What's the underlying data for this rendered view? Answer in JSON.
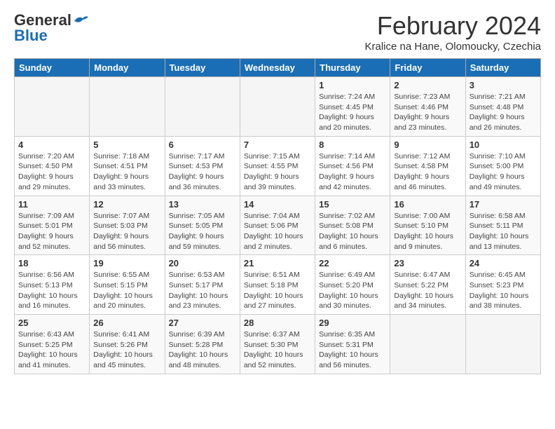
{
  "header": {
    "logo_general": "General",
    "logo_blue": "Blue",
    "month_title": "February 2024",
    "subtitle": "Kralice na Hane, Olomoucky, Czechia"
  },
  "days_of_week": [
    "Sunday",
    "Monday",
    "Tuesday",
    "Wednesday",
    "Thursday",
    "Friday",
    "Saturday"
  ],
  "weeks": [
    [
      {
        "day": null
      },
      {
        "day": null
      },
      {
        "day": null
      },
      {
        "day": null
      },
      {
        "day": 1,
        "sunrise": "7:24 AM",
        "sunset": "4:45 PM",
        "daylight": "9 hours and 20 minutes."
      },
      {
        "day": 2,
        "sunrise": "7:23 AM",
        "sunset": "4:46 PM",
        "daylight": "9 hours and 23 minutes."
      },
      {
        "day": 3,
        "sunrise": "7:21 AM",
        "sunset": "4:48 PM",
        "daylight": "9 hours and 26 minutes."
      }
    ],
    [
      {
        "day": 4,
        "sunrise": "7:20 AM",
        "sunset": "4:50 PM",
        "daylight": "9 hours and 29 minutes."
      },
      {
        "day": 5,
        "sunrise": "7:18 AM",
        "sunset": "4:51 PM",
        "daylight": "9 hours and 33 minutes."
      },
      {
        "day": 6,
        "sunrise": "7:17 AM",
        "sunset": "4:53 PM",
        "daylight": "9 hours and 36 minutes."
      },
      {
        "day": 7,
        "sunrise": "7:15 AM",
        "sunset": "4:55 PM",
        "daylight": "9 hours and 39 minutes."
      },
      {
        "day": 8,
        "sunrise": "7:14 AM",
        "sunset": "4:56 PM",
        "daylight": "9 hours and 42 minutes."
      },
      {
        "day": 9,
        "sunrise": "7:12 AM",
        "sunset": "4:58 PM",
        "daylight": "9 hours and 46 minutes."
      },
      {
        "day": 10,
        "sunrise": "7:10 AM",
        "sunset": "5:00 PM",
        "daylight": "9 hours and 49 minutes."
      }
    ],
    [
      {
        "day": 11,
        "sunrise": "7:09 AM",
        "sunset": "5:01 PM",
        "daylight": "9 hours and 52 minutes."
      },
      {
        "day": 12,
        "sunrise": "7:07 AM",
        "sunset": "5:03 PM",
        "daylight": "9 hours and 56 minutes."
      },
      {
        "day": 13,
        "sunrise": "7:05 AM",
        "sunset": "5:05 PM",
        "daylight": "9 hours and 59 minutes."
      },
      {
        "day": 14,
        "sunrise": "7:04 AM",
        "sunset": "5:06 PM",
        "daylight": "10 hours and 2 minutes."
      },
      {
        "day": 15,
        "sunrise": "7:02 AM",
        "sunset": "5:08 PM",
        "daylight": "10 hours and 6 minutes."
      },
      {
        "day": 16,
        "sunrise": "7:00 AM",
        "sunset": "5:10 PM",
        "daylight": "10 hours and 9 minutes."
      },
      {
        "day": 17,
        "sunrise": "6:58 AM",
        "sunset": "5:11 PM",
        "daylight": "10 hours and 13 minutes."
      }
    ],
    [
      {
        "day": 18,
        "sunrise": "6:56 AM",
        "sunset": "5:13 PM",
        "daylight": "10 hours and 16 minutes."
      },
      {
        "day": 19,
        "sunrise": "6:55 AM",
        "sunset": "5:15 PM",
        "daylight": "10 hours and 20 minutes."
      },
      {
        "day": 20,
        "sunrise": "6:53 AM",
        "sunset": "5:17 PM",
        "daylight": "10 hours and 23 minutes."
      },
      {
        "day": 21,
        "sunrise": "6:51 AM",
        "sunset": "5:18 PM",
        "daylight": "10 hours and 27 minutes."
      },
      {
        "day": 22,
        "sunrise": "6:49 AM",
        "sunset": "5:20 PM",
        "daylight": "10 hours and 30 minutes."
      },
      {
        "day": 23,
        "sunrise": "6:47 AM",
        "sunset": "5:22 PM",
        "daylight": "10 hours and 34 minutes."
      },
      {
        "day": 24,
        "sunrise": "6:45 AM",
        "sunset": "5:23 PM",
        "daylight": "10 hours and 38 minutes."
      }
    ],
    [
      {
        "day": 25,
        "sunrise": "6:43 AM",
        "sunset": "5:25 PM",
        "daylight": "10 hours and 41 minutes."
      },
      {
        "day": 26,
        "sunrise": "6:41 AM",
        "sunset": "5:26 PM",
        "daylight": "10 hours and 45 minutes."
      },
      {
        "day": 27,
        "sunrise": "6:39 AM",
        "sunset": "5:28 PM",
        "daylight": "10 hours and 48 minutes."
      },
      {
        "day": 28,
        "sunrise": "6:37 AM",
        "sunset": "5:30 PM",
        "daylight": "10 hours and 52 minutes."
      },
      {
        "day": 29,
        "sunrise": "6:35 AM",
        "sunset": "5:31 PM",
        "daylight": "10 hours and 56 minutes."
      },
      {
        "day": null
      },
      {
        "day": null
      }
    ]
  ],
  "daylight_label": "Daylight:",
  "sunrise_label": "Sunrise:",
  "sunset_label": "Sunset:"
}
